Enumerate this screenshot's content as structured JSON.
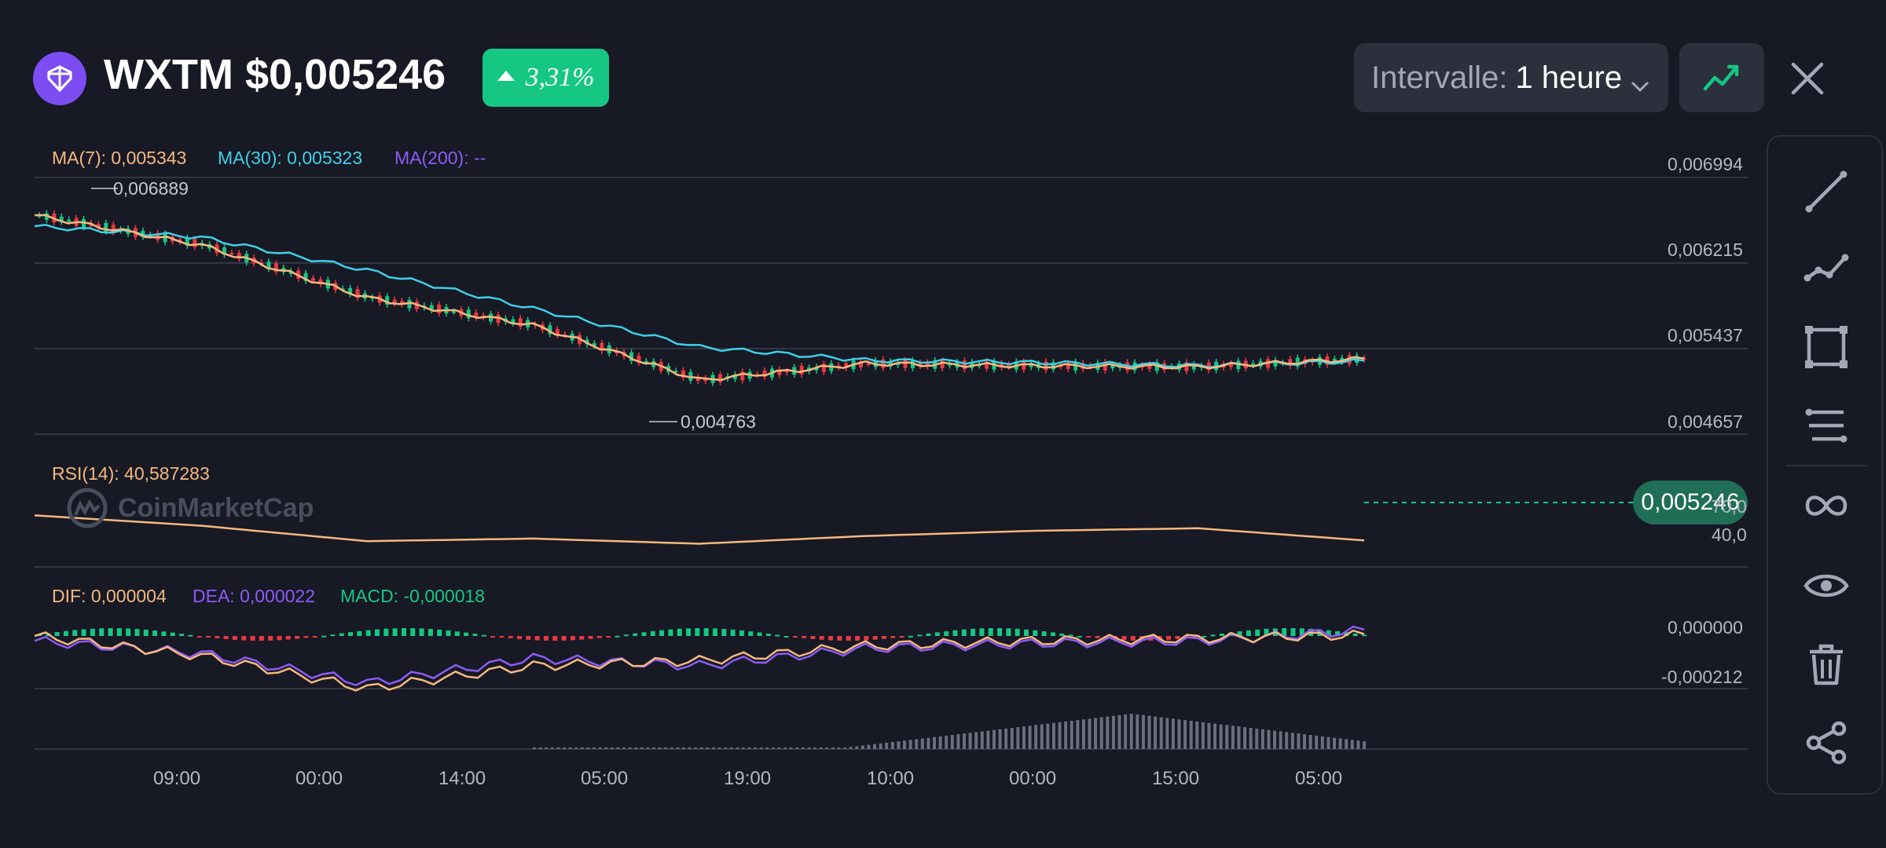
{
  "header": {
    "token_icon": "wxtm-logo-icon",
    "title": "WXTM $0,005246",
    "change_percent": "3,31%",
    "change_direction": "up",
    "interval_label": "Intervalle:",
    "interval_value": "1 heure",
    "chart_type_icon": "line-chart-icon",
    "close_icon": "close-icon"
  },
  "colors": {
    "background": "#171924",
    "ma7": "#f6b87e",
    "ma30": "#3ed0e8",
    "ma200": "#8b5cf6",
    "up": "#16c784",
    "down": "#ea3943",
    "rsi": "#f6b87e",
    "dif": "#f6b87e",
    "dea": "#8b5cf6",
    "macd": "#16c784"
  },
  "legend": {
    "ma7": "MA(7): 0,005343",
    "ma30": "MA(30): 0,005323",
    "ma200": "MA(200): --",
    "rsi": "RSI(14): 40,587283",
    "dif": "DIF: 0,000004",
    "dea": "DEA: 0,000022",
    "macd": "MACD: -0,000018"
  },
  "price_axis": [
    "0,006994",
    "0,006215",
    "0,005437",
    "0,004657"
  ],
  "current_price": "0,005246",
  "high_marker": "0,006889",
  "low_marker": "0,004763",
  "rsi_axis": [
    "70,0",
    "40,0"
  ],
  "macd_axis": [
    "0,000000",
    "-0,000212"
  ],
  "time_axis": [
    "09:00",
    "00:00",
    "14:00",
    "05:00",
    "19:00",
    "10:00",
    "00:00",
    "15:00",
    "05:00"
  ],
  "watermark": "CoinMarketCap",
  "toolbar": [
    {
      "icon": "trend-line-icon"
    },
    {
      "icon": "polyline-icon"
    },
    {
      "icon": "rectangle-icon"
    },
    {
      "icon": "parallel-lines-icon"
    },
    {
      "icon": "infinity-icon"
    },
    {
      "icon": "eye-icon"
    },
    {
      "icon": "trash-icon"
    },
    {
      "icon": "share-icon"
    }
  ],
  "chart_data": {
    "type": "line",
    "title": "",
    "xlabel": "",
    "ylabel": "",
    "ylim": [
      0.004657,
      0.006994
    ],
    "grid": true,
    "x": [
      "09:00",
      "00:00",
      "14:00",
      "05:00",
      "19:00",
      "10:00",
      "00:00",
      "15:00",
      "05:00"
    ],
    "series": [
      {
        "name": "MA(7)",
        "values": [
          0.00665,
          0.00638,
          0.0059,
          0.00565,
          0.00515,
          0.0053,
          0.00528,
          0.00527,
          0.005343
        ]
      },
      {
        "name": "MA(30)",
        "values": [
          0.00655,
          0.00645,
          0.00615,
          0.0058,
          0.00545,
          0.00533,
          0.00531,
          0.00528,
          0.005323
        ]
      },
      {
        "name": "RSI(14)",
        "values": [
          60,
          52,
          40,
          42,
          38,
          44,
          48,
          50,
          40.587283
        ]
      },
      {
        "name": "DIF",
        "values": [
          0.0,
          -8e-05,
          -0.000212,
          -0.00012,
          -0.0001,
          -4e-05,
          -2e-05,
          -1e-05,
          4e-06
        ]
      },
      {
        "name": "DEA",
        "values": [
          -2e-05,
          -7e-05,
          -0.00019,
          -9e-05,
          -0.00012,
          -5e-05,
          -3e-05,
          -2e-05,
          2.2e-05
        ]
      }
    ]
  }
}
